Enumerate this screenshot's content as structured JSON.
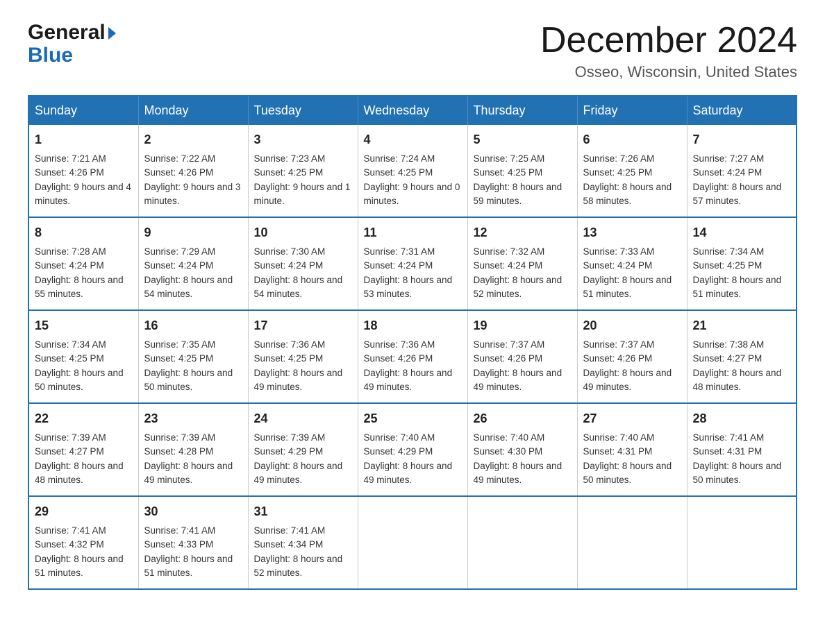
{
  "header": {
    "logo_general": "General",
    "logo_blue": "Blue",
    "month_title": "December 2024",
    "location": "Osseo, Wisconsin, United States"
  },
  "weekdays": [
    "Sunday",
    "Monday",
    "Tuesday",
    "Wednesday",
    "Thursday",
    "Friday",
    "Saturday"
  ],
  "weeks": [
    [
      {
        "day": "1",
        "sunrise": "7:21 AM",
        "sunset": "4:26 PM",
        "daylight": "9 hours and 4 minutes."
      },
      {
        "day": "2",
        "sunrise": "7:22 AM",
        "sunset": "4:26 PM",
        "daylight": "9 hours and 3 minutes."
      },
      {
        "day": "3",
        "sunrise": "7:23 AM",
        "sunset": "4:25 PM",
        "daylight": "9 hours and 1 minute."
      },
      {
        "day": "4",
        "sunrise": "7:24 AM",
        "sunset": "4:25 PM",
        "daylight": "9 hours and 0 minutes."
      },
      {
        "day": "5",
        "sunrise": "7:25 AM",
        "sunset": "4:25 PM",
        "daylight": "8 hours and 59 minutes."
      },
      {
        "day": "6",
        "sunrise": "7:26 AM",
        "sunset": "4:25 PM",
        "daylight": "8 hours and 58 minutes."
      },
      {
        "day": "7",
        "sunrise": "7:27 AM",
        "sunset": "4:24 PM",
        "daylight": "8 hours and 57 minutes."
      }
    ],
    [
      {
        "day": "8",
        "sunrise": "7:28 AM",
        "sunset": "4:24 PM",
        "daylight": "8 hours and 55 minutes."
      },
      {
        "day": "9",
        "sunrise": "7:29 AM",
        "sunset": "4:24 PM",
        "daylight": "8 hours and 54 minutes."
      },
      {
        "day": "10",
        "sunrise": "7:30 AM",
        "sunset": "4:24 PM",
        "daylight": "8 hours and 54 minutes."
      },
      {
        "day": "11",
        "sunrise": "7:31 AM",
        "sunset": "4:24 PM",
        "daylight": "8 hours and 53 minutes."
      },
      {
        "day": "12",
        "sunrise": "7:32 AM",
        "sunset": "4:24 PM",
        "daylight": "8 hours and 52 minutes."
      },
      {
        "day": "13",
        "sunrise": "7:33 AM",
        "sunset": "4:24 PM",
        "daylight": "8 hours and 51 minutes."
      },
      {
        "day": "14",
        "sunrise": "7:34 AM",
        "sunset": "4:25 PM",
        "daylight": "8 hours and 51 minutes."
      }
    ],
    [
      {
        "day": "15",
        "sunrise": "7:34 AM",
        "sunset": "4:25 PM",
        "daylight": "8 hours and 50 minutes."
      },
      {
        "day": "16",
        "sunrise": "7:35 AM",
        "sunset": "4:25 PM",
        "daylight": "8 hours and 50 minutes."
      },
      {
        "day": "17",
        "sunrise": "7:36 AM",
        "sunset": "4:25 PM",
        "daylight": "8 hours and 49 minutes."
      },
      {
        "day": "18",
        "sunrise": "7:36 AM",
        "sunset": "4:26 PM",
        "daylight": "8 hours and 49 minutes."
      },
      {
        "day": "19",
        "sunrise": "7:37 AM",
        "sunset": "4:26 PM",
        "daylight": "8 hours and 49 minutes."
      },
      {
        "day": "20",
        "sunrise": "7:37 AM",
        "sunset": "4:26 PM",
        "daylight": "8 hours and 49 minutes."
      },
      {
        "day": "21",
        "sunrise": "7:38 AM",
        "sunset": "4:27 PM",
        "daylight": "8 hours and 48 minutes."
      }
    ],
    [
      {
        "day": "22",
        "sunrise": "7:39 AM",
        "sunset": "4:27 PM",
        "daylight": "8 hours and 48 minutes."
      },
      {
        "day": "23",
        "sunrise": "7:39 AM",
        "sunset": "4:28 PM",
        "daylight": "8 hours and 49 minutes."
      },
      {
        "day": "24",
        "sunrise": "7:39 AM",
        "sunset": "4:29 PM",
        "daylight": "8 hours and 49 minutes."
      },
      {
        "day": "25",
        "sunrise": "7:40 AM",
        "sunset": "4:29 PM",
        "daylight": "8 hours and 49 minutes."
      },
      {
        "day": "26",
        "sunrise": "7:40 AM",
        "sunset": "4:30 PM",
        "daylight": "8 hours and 49 minutes."
      },
      {
        "day": "27",
        "sunrise": "7:40 AM",
        "sunset": "4:31 PM",
        "daylight": "8 hours and 50 minutes."
      },
      {
        "day": "28",
        "sunrise": "7:41 AM",
        "sunset": "4:31 PM",
        "daylight": "8 hours and 50 minutes."
      }
    ],
    [
      {
        "day": "29",
        "sunrise": "7:41 AM",
        "sunset": "4:32 PM",
        "daylight": "8 hours and 51 minutes."
      },
      {
        "day": "30",
        "sunrise": "7:41 AM",
        "sunset": "4:33 PM",
        "daylight": "8 hours and 51 minutes."
      },
      {
        "day": "31",
        "sunrise": "7:41 AM",
        "sunset": "4:34 PM",
        "daylight": "8 hours and 52 minutes."
      },
      null,
      null,
      null,
      null
    ]
  ]
}
